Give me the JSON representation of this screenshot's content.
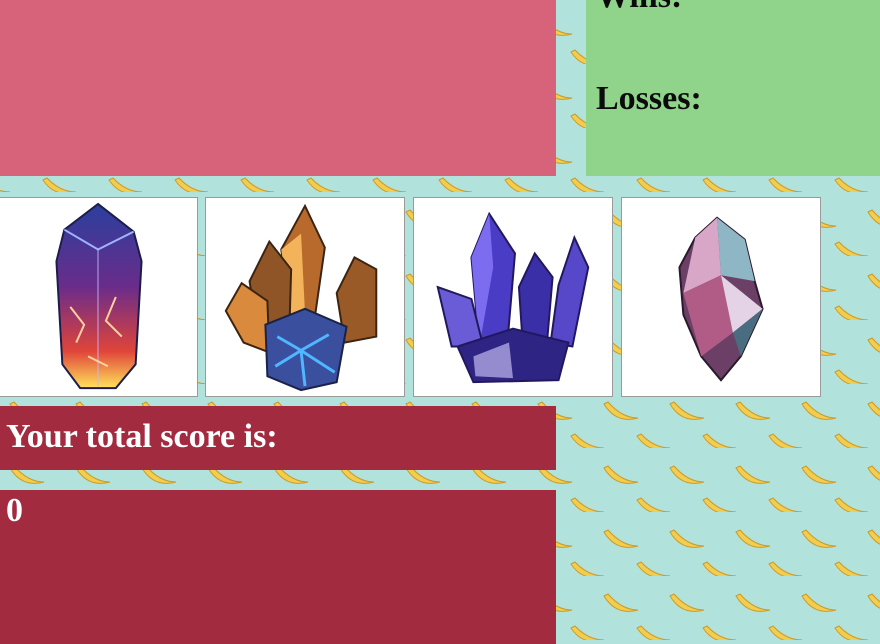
{
  "colors": {
    "background": "#b2e2dc",
    "target_panel": "#d6637a",
    "stats_panel": "#90d48c",
    "score_panel": "#a22b40",
    "banana": "#f3cd4e"
  },
  "background_pattern": "banana-pattern",
  "stats": {
    "wins_label": "Wins:",
    "losses_label": "Losses:"
  },
  "crystals": [
    {
      "icon": "red-purple-crystal-icon"
    },
    {
      "icon": "blue-orange-crystal-cluster-icon"
    },
    {
      "icon": "purple-crystal-cluster-icon"
    },
    {
      "icon": "pink-teal-crystal-icon"
    }
  ],
  "score": {
    "label": "Your total score is:",
    "value": "0"
  }
}
